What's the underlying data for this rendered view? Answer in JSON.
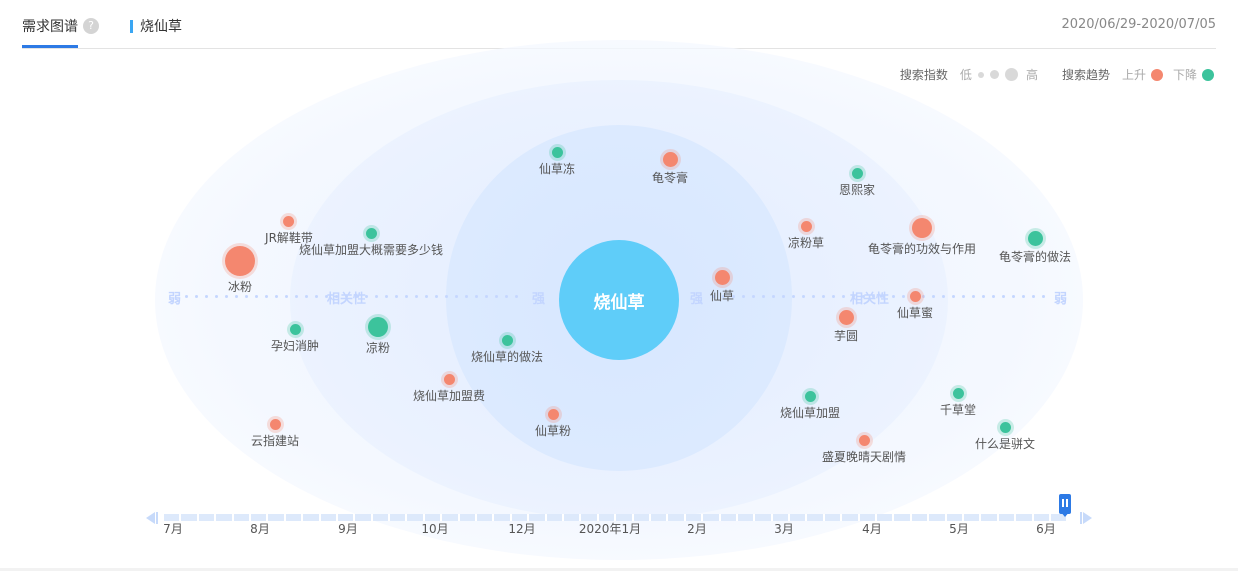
{
  "header": {
    "tab_title": "需求图谱",
    "help_glyph": "?",
    "keyword": "烧仙草",
    "date_range": "2020/06/29-2020/07/05"
  },
  "legend": {
    "search_index_label": "搜索指数",
    "low_label": "低",
    "high_label": "高",
    "trend_label": "搜索趋势",
    "up_label": "上升",
    "down_label": "下降"
  },
  "colors": {
    "up": "#f4876f",
    "down": "#3cc39c",
    "center": "#5fcdf9",
    "accent": "#2d7ae5"
  },
  "axis": {
    "weak_left": "弱",
    "relevance_left": "相关性",
    "strong_left": "强",
    "strong_right": "强",
    "relevance_right": "相关性",
    "weak_right": "弱"
  },
  "center": {
    "label": "烧仙草"
  },
  "nodes": [
    {
      "label": "仙草冻",
      "trend": "down",
      "index": 2
    },
    {
      "label": "龟苓膏",
      "trend": "up",
      "index": 3
    },
    {
      "label": "恩熙家",
      "trend": "down",
      "index": 2
    },
    {
      "label": "JR解鞋带",
      "trend": "up",
      "index": 2
    },
    {
      "label": "烧仙草加盟大概需要多少钱",
      "trend": "down",
      "index": 2
    },
    {
      "label": "凉粉草",
      "trend": "up",
      "index": 2
    },
    {
      "label": "龟苓膏的功效与作用",
      "trend": "up",
      "index": 4
    },
    {
      "label": "龟苓膏的做法",
      "trend": "down",
      "index": 3
    },
    {
      "label": "冰粉",
      "trend": "up",
      "index": 5
    },
    {
      "label": "仙草",
      "trend": "up",
      "index": 3
    },
    {
      "label": "仙草蜜",
      "trend": "up",
      "index": 2
    },
    {
      "label": "孕妇消肿",
      "trend": "down",
      "index": 2
    },
    {
      "label": "凉粉",
      "trend": "down",
      "index": 4
    },
    {
      "label": "芋圆",
      "trend": "up",
      "index": 3
    },
    {
      "label": "烧仙草的做法",
      "trend": "down",
      "index": 2
    },
    {
      "label": "烧仙草加盟费",
      "trend": "up",
      "index": 2
    },
    {
      "label": "仙草粉",
      "trend": "up",
      "index": 2
    },
    {
      "label": "烧仙草加盟",
      "trend": "down",
      "index": 2
    },
    {
      "label": "千草堂",
      "trend": "down",
      "index": 2
    },
    {
      "label": "云指建站",
      "trend": "up",
      "index": 2
    },
    {
      "label": "盛夏晚晴天剧情",
      "trend": "up",
      "index": 2
    },
    {
      "label": "什么是骈文",
      "trend": "down",
      "index": 2
    }
  ],
  "timeline": {
    "months": [
      "7月",
      "8月",
      "9月",
      "10月",
      "12月",
      "2020年1月",
      "2月",
      "3月",
      "4月",
      "5月",
      "6月"
    ],
    "selected": "6月"
  }
}
